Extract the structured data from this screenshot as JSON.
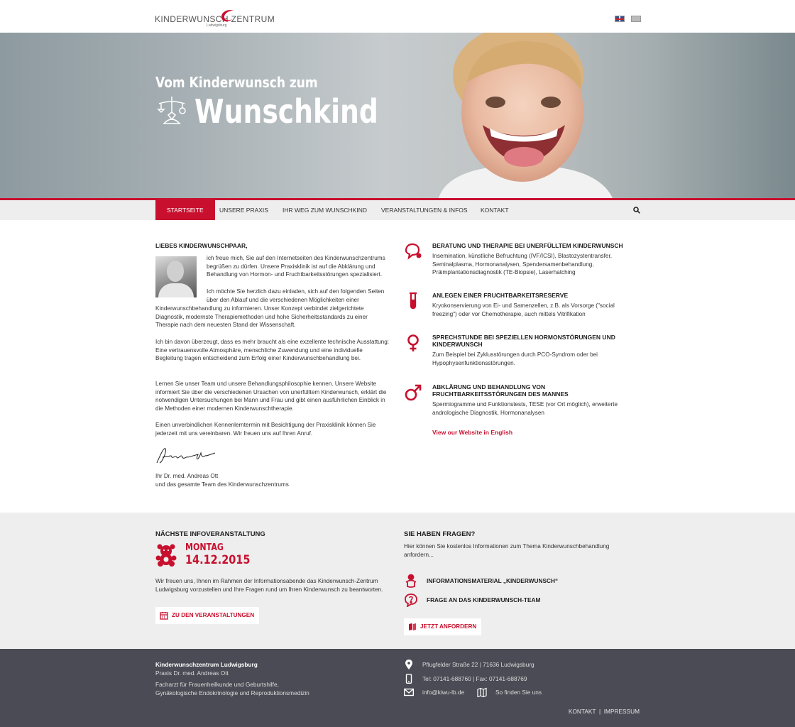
{
  "header": {
    "logo_text": "KINDERWUNSCH    ZENTRUM",
    "logo_sub": "Ludwigsburg",
    "flags": [
      "english-flag",
      "turkish-flag"
    ]
  },
  "hero": {
    "title_small": "Vom Kinderwunsch zum",
    "title_big": "Wunschkind"
  },
  "nav": {
    "items": [
      "STARTSEITE",
      "UNSERE PRAXIS",
      "IHR WEG ZUM WUNSCHKIND",
      "VERANSTALTUNGEN & INFOS",
      "KONTAKT"
    ],
    "active": "STARTSEITE"
  },
  "welcome": {
    "heading": "LIEBES KINDERWUNSCHPAAR,",
    "p1": "ich freue mich, Sie auf den Internetseiten des Kinderwunschzentrums begrüßen zu dürfen. Unsere Praxisklinik ist auf die Abklärung und Behandlung von Hormon- und Fruchtbarkeitsstörungen spezialisiert.",
    "p2a": "Ich möchte Sie herzlich dazu einladen, sich auf den folgenden Seiten über den Ablauf und die verschiedenen Möglichkeiten einer",
    "p2b": "Kinderwunschbehandlung zu informieren. Unser Konzept verbindet zielgerichtete Diagnostik, modernste Therapiemethoden und hohe Sicherheitsstandards zu einer Therapie nach dem neuesten Stand der Wissenschaft.",
    "p3": "Ich bin davon überzeugt, dass es mehr braucht als eine exzellente technische Ausstattung: Eine vertrauensvolle Atmosphäre, menschliche Zuwendung und eine individuelle Begleitung tragen entscheidend zum Erfolg einer Kinderwunschbehandlung bei.",
    "p4": "Lernen Sie unser Team und unsere Behandlungsphilosophie kennen. Unsere Website informiert Sie über die verschiedenen Ursachen von unerfülltem Kinderwunsch, erklärt die notwendigen Untersuchungen bei Mann und Frau und gibt einen ausführlichen Einblick in die Methoden einer modernen Kinderwunschtherapie.",
    "p5": "Einen unverbindlichen Kennenlerntermin mit Besichtigung der Praxisklinik können Sie jederzeit mit uns vereinbaren. Wir freuen uns auf Ihren Anruf.",
    "closing1": "Ihr Dr. med. Andreas Ott",
    "closing2": "und das gesamte Team des Kinderwunschzentrums"
  },
  "services": [
    {
      "icon": "speech-bubbles-icon",
      "title": "BERATUNG UND THERAPIE BEI UNERFÜLLTEM KINDERWUNSCH",
      "text": "Insemination, künstliche Befruchtung (IVF/ICSI), Blastozystentransfer, Seminalplasma, Hormonanalysen, Spendersamenbehandlung, Präimplantationsdiagnostik (TE-Biopsie), Laserhatching"
    },
    {
      "icon": "test-tube-icon",
      "title": "ANLEGEN EINER FRUCHTBARKEITSRESERVE",
      "text": "Kryokonservierung von Ei- und Samenzellen, z.B. als Vorsorge (\"social freezing\") oder vor Chemotherapie, auch mittels Vitrifikation"
    },
    {
      "icon": "female-symbol-icon",
      "title": "SPRECHSTUNDE BEI SPEZIELLEN HORMONSTÖRUNGEN UND KINDERWUNSCH",
      "text": "Zum Beispiel bei Zyklusstörungen durch PCO-Syndrom oder bei Hypophysenfunktionsstörungen."
    },
    {
      "icon": "male-symbol-icon",
      "title": "ABKLÄRUNG UND BEHANDLUNG VON FRUCHTBARKEITSSTÖRUNGEN DES MANNES",
      "text": "Spermiogramme und Funktionstests, TESE (vor Ort möglich), erweiterte andrologische Diagnostik, Hormonanalysen"
    }
  ],
  "english_link": "View our Website in English",
  "event": {
    "heading": "NÄCHSTE INFOVERANSTALTUNG",
    "day": "MONTAG",
    "date": "14.12.2015",
    "text": "Wir freuen uns, Ihnen im Rahmen der Informationsabende das Kinderwunsch-Zentrum Ludwigsburg vorzustellen und Ihre Fragen rund um Ihren Kinderwunsch zu beantworten.",
    "button": "ZU DEN VERANSTALTUNGEN"
  },
  "questions": {
    "heading": "SIE HABEN FRAGEN?",
    "text": "Hier können Sie kostenlos Informationen zum Thema Kinderwunschbehandlung anfordern...",
    "item1": "INFORMATIONSMATERIAL „KINDERWUNSCH“",
    "item2": "FRAGE AN DAS KINDERWUNSCH-TEAM",
    "button": "JETZT ANFORDERN"
  },
  "footer": {
    "name": "Kinderwunschzentrum Ludwigsburg",
    "praxis": "Praxis Dr. med. Andreas Ott",
    "line3": "Facharzt für Frauenheilkunde und Geburtshilfe,",
    "line4": "Gynäkologische Endokrinologie und Reproduktionsmedizin",
    "address": "Pflugfelder Straße 22 | 71636 Ludwigsburg",
    "phone": "Tel: 07141-688760 | Fax: 07141-688769",
    "email": "info@kiwu-lb.de",
    "directions": "So finden Sie uns",
    "link_contact": "KONTAKT",
    "separator": "|",
    "link_imprint": "IMPRESSUM"
  },
  "colors": {
    "accent": "#c8102e",
    "footer_bg": "#4a4b54",
    "grey_bg": "#eeeeef"
  }
}
